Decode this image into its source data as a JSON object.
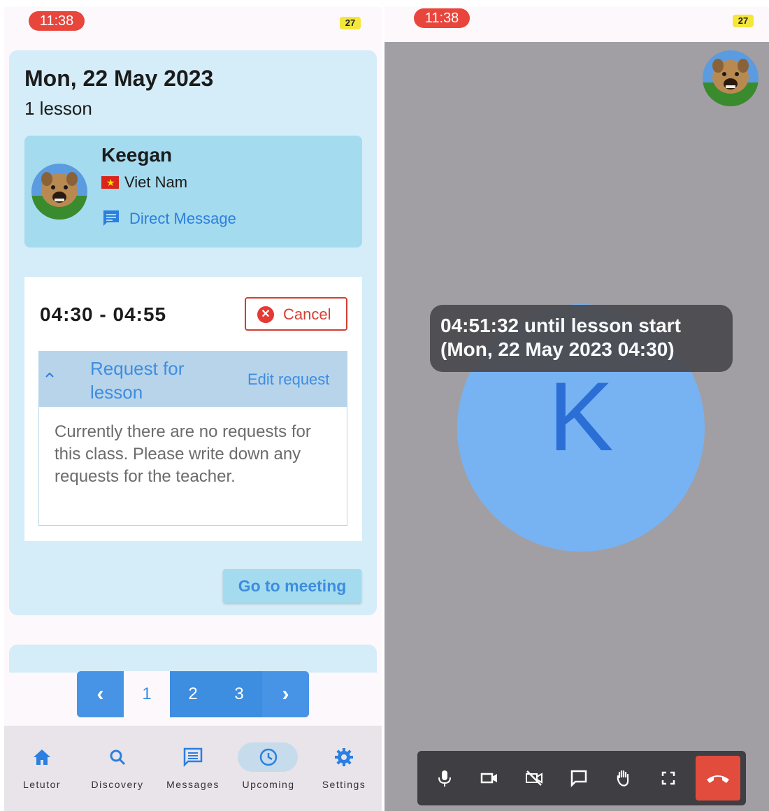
{
  "left_screen": {
    "status_time": "11:38",
    "battery": "27",
    "day": {
      "title": "Mon, 22 May 2023",
      "lesson_count": "1 lesson"
    },
    "tutor": {
      "name": "Keegan",
      "country": "Viet Nam",
      "direct_message_label": "Direct Message"
    },
    "lesson": {
      "time_range": "04:30 - 04:55",
      "cancel_label": "Cancel",
      "request_title": "Request for lesson",
      "edit_request_label": "Edit request",
      "request_text": "Currently there are no requests for this class. Please write down any requests for the teacher.",
      "go_to_meeting_label": "Go to meeting"
    },
    "pagination": {
      "prev_label": "‹",
      "pages": [
        "1",
        "2",
        "3"
      ],
      "current_page": "1",
      "next_label": "›"
    },
    "bottom_nav": [
      {
        "label": "Letutor",
        "icon": "home-icon"
      },
      {
        "label": "Discovery",
        "icon": "search-icon"
      },
      {
        "label": "Messages",
        "icon": "message-icon"
      },
      {
        "label": "Upcoming",
        "icon": "clock-icon",
        "active": true
      },
      {
        "label": "Settings",
        "icon": "gear-icon"
      }
    ]
  },
  "right_screen": {
    "status_time": "11:38",
    "battery": "27",
    "participant_initial": "K",
    "countdown_line1": "04:51:32 until lesson start",
    "countdown_line2": "(Mon, 22 May 2023 04:30)",
    "toolbar": [
      "microphone-icon",
      "camera-icon",
      "camera-off-icon",
      "chat-icon",
      "raise-hand-icon",
      "fullscreen-icon",
      "hang-up-icon"
    ]
  },
  "colors": {
    "accent_blue": "#3d8de0",
    "card_bg": "#d4edf8",
    "tutor_card_bg": "#a5dbee",
    "cancel_red": "#d33f33",
    "meeting_bg": "#a19fa3",
    "avatar_circle": "#77b3f3",
    "hangup_red": "#e24c3c"
  }
}
